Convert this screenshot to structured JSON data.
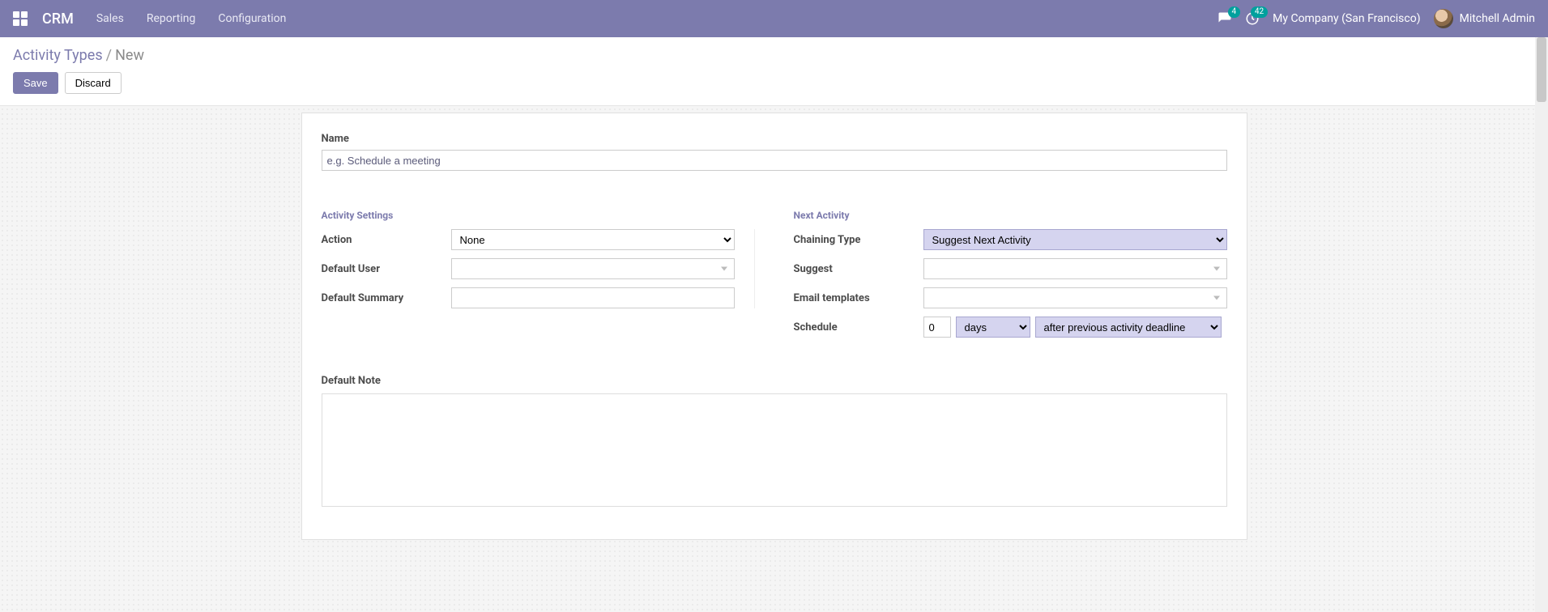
{
  "nav": {
    "brand": "CRM",
    "links": [
      "Sales",
      "Reporting",
      "Configuration"
    ],
    "msg_badge": "4",
    "activity_badge": "42",
    "company": "My Company (San Francisco)",
    "user": "Mitchell Admin"
  },
  "breadcrumb": {
    "parent": "Activity Types",
    "current": "New"
  },
  "buttons": {
    "save": "Save",
    "discard": "Discard"
  },
  "form": {
    "name_label": "Name",
    "name_placeholder": "e.g. Schedule a meeting",
    "sections": {
      "settings_title": "Activity Settings",
      "next_title": "Next Activity"
    },
    "left": {
      "action_label": "Action",
      "action_value": "None",
      "default_user_label": "Default User",
      "default_summary_label": "Default Summary"
    },
    "right": {
      "chaining_label": "Chaining Type",
      "chaining_value": "Suggest Next Activity",
      "suggest_label": "Suggest",
      "email_tmpl_label": "Email templates",
      "schedule_label": "Schedule",
      "schedule_num": "0",
      "schedule_unit": "days",
      "schedule_kind": "after previous activity deadline"
    },
    "default_note_label": "Default Note"
  }
}
